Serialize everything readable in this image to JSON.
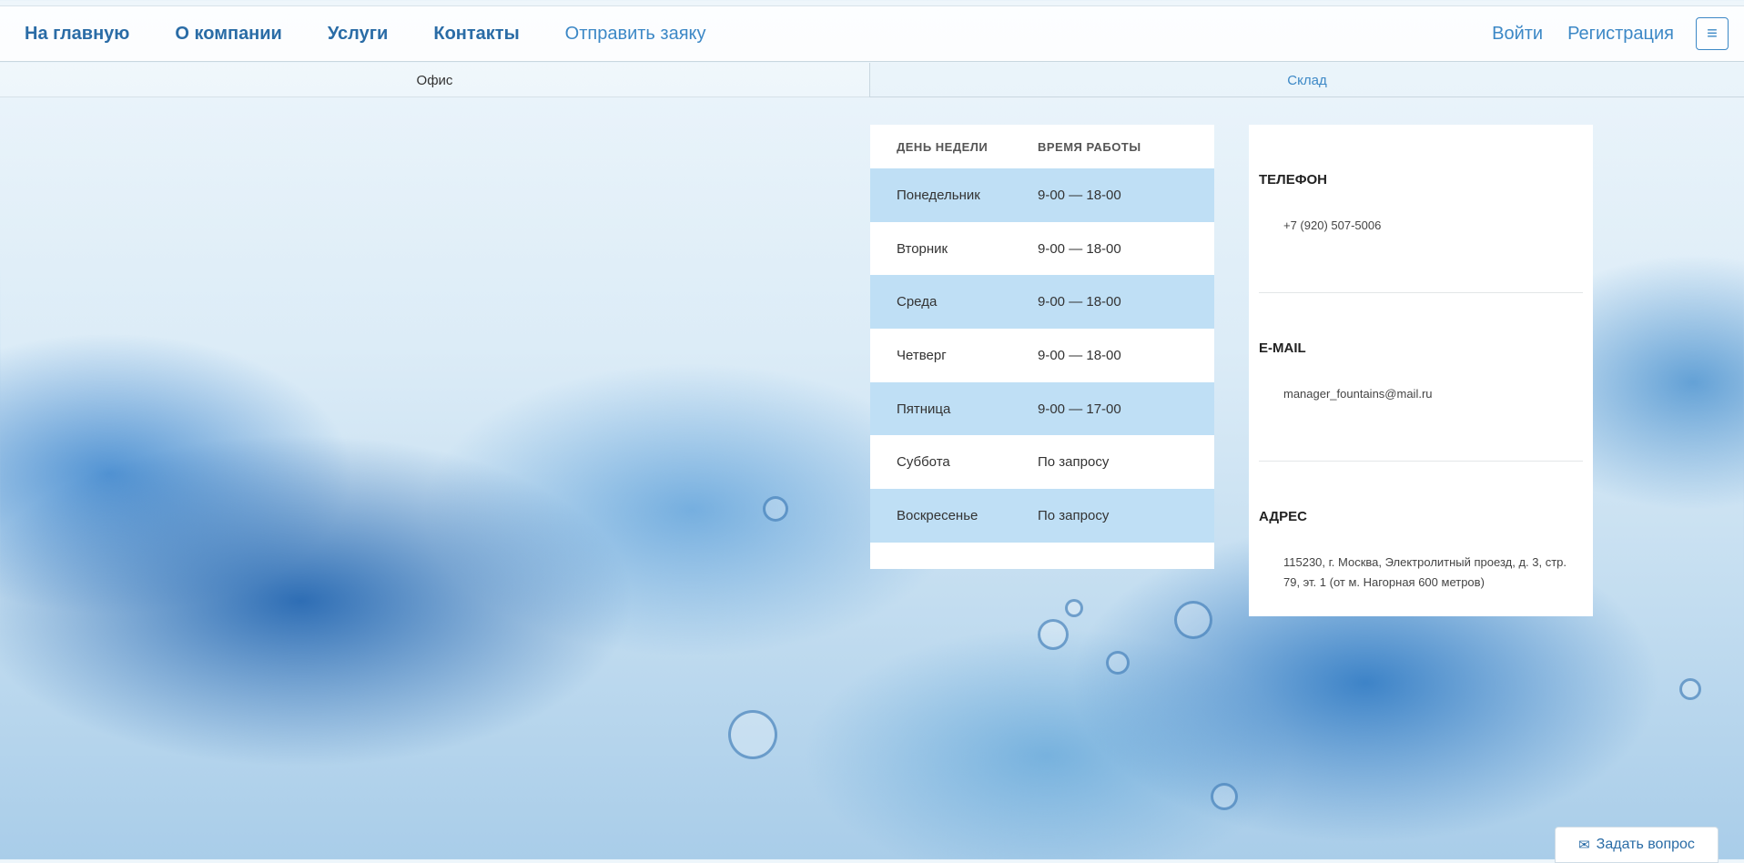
{
  "nav": {
    "items": [
      {
        "label": "На главную"
      },
      {
        "label": "О компании"
      },
      {
        "label": "Услуги"
      },
      {
        "label": "Контакты"
      },
      {
        "label": "Отправить заяку"
      }
    ],
    "login": "Войти",
    "register": "Регистрация",
    "menu_icon": "hamburger-icon"
  },
  "tabs": [
    {
      "label": "Офис",
      "active": true
    },
    {
      "label": "Склад",
      "active": false
    }
  ],
  "schedule": {
    "headers": [
      "ДЕНЬ НЕДЕЛИ",
      "ВРЕМЯ РАБОТЫ"
    ],
    "rows": [
      {
        "day": "Понедельник",
        "hours": "9-00 — 18-00"
      },
      {
        "day": "Вторник",
        "hours": "9-00 — 18-00"
      },
      {
        "day": "Среда",
        "hours": "9-00 — 18-00"
      },
      {
        "day": "Четверг",
        "hours": "9-00 — 18-00"
      },
      {
        "day": "Пятница",
        "hours": "9-00 — 17-00"
      },
      {
        "day": "Суббота",
        "hours": "По запросу"
      },
      {
        "day": "Воскресенье",
        "hours": "По запросу"
      }
    ]
  },
  "contacts": {
    "phone": {
      "title": "ТЕЛЕФОН",
      "value": "+7 (920) 507-5006"
    },
    "email": {
      "title": "E-MAIL",
      "value": "manager_fountains@mail.ru"
    },
    "address": {
      "title": "АДРЕС",
      "value": "115230, г. Москва, Электролитный проезд, д. 3, стр. 79, эт. 1 (от м. Нагорная 600 метров)"
    }
  },
  "ask_button": {
    "label": "Задать вопрос",
    "icon": "envelope-icon"
  },
  "colors": {
    "accent": "#3c88c6",
    "accent_dark": "#2a6ca6",
    "row_shade": "#bfdff5"
  }
}
